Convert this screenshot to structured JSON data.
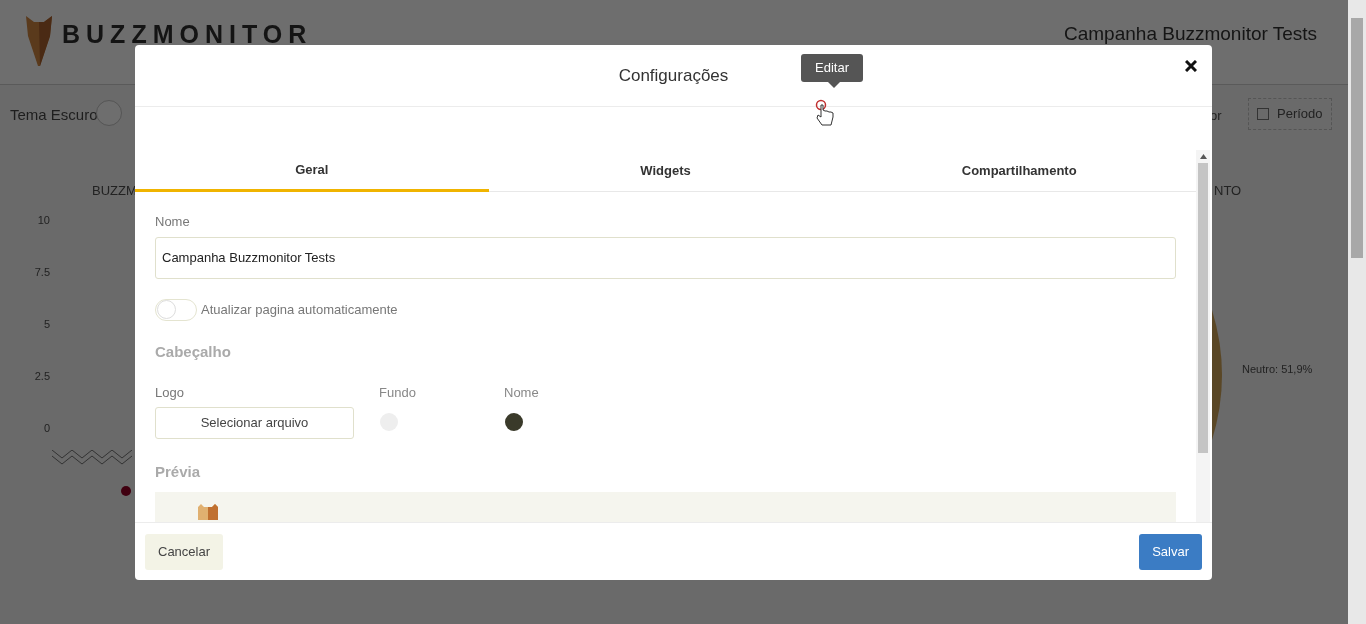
{
  "background": {
    "logo": "BUZZMONITOR",
    "title": "Campanha Buzzmonitor Tests",
    "theme_toggle": {
      "label": "Tema Escuro",
      "on": false
    },
    "toolbar_buttons": [
      "or",
      "Período"
    ],
    "chart_left": {
      "title": "BUZZM",
      "yticks": [
        "10",
        "7.5",
        "5",
        "2.5",
        "0"
      ]
    },
    "chart_right": {
      "title": "NTO",
      "label": "Neutro: 51,9%"
    }
  },
  "dialog": {
    "title": "Configurações",
    "tooltip": "Editar",
    "tabs": [
      {
        "label": "Geral",
        "selected": true
      },
      {
        "label": "Widgets",
        "selected": false
      },
      {
        "label": "Compartilhamento",
        "selected": false
      }
    ],
    "name_field": {
      "label": "Nome",
      "value": "Campanha Buzzmonitor Tests"
    },
    "auto_refresh": {
      "label": "Atualizar pagina automaticamente",
      "on": false
    },
    "header_section": {
      "title": "Cabeçalho",
      "logo_label": "Logo",
      "logo_button": "Selecionar arquivo",
      "colors": [
        {
          "label": "Fundo",
          "color": "#eeeeee"
        },
        {
          "label": "Nome",
          "color": "#3a3a2a"
        }
      ]
    },
    "preview": {
      "title": "Prévia"
    },
    "buttons": {
      "cancel": "Cancelar",
      "save": "Salvar"
    }
  }
}
